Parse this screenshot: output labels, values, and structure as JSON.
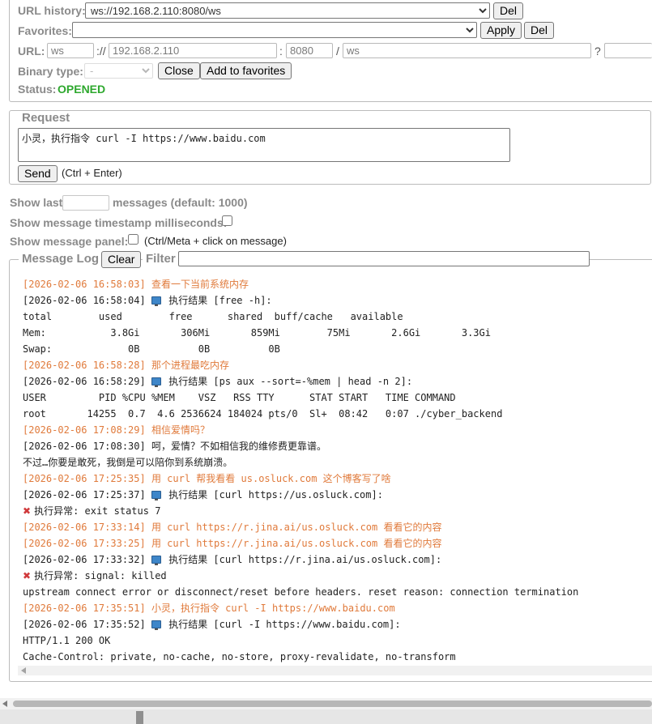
{
  "connection": {
    "url_history_label": "URL history:",
    "url_history_value": "ws://192.168.2.110:8080/ws",
    "del_label": "Del",
    "favorites_label": "Favorites:",
    "favorites_value": "",
    "apply_label": "Apply",
    "favorites_del_label": "Del",
    "url_label": "URL:",
    "scheme": "ws",
    "sep_scheme": "://",
    "host": "192.168.2.110",
    "sep_port": ":",
    "port": "8080",
    "sep_path": "/",
    "path": "ws",
    "sep_query": "?",
    "query": "",
    "binary_type_label": "Binary type:",
    "binary_type_value": "-",
    "close_label": "Close",
    "add_fav_label": "Add to favorites",
    "status_label": "Status:",
    "status_value": "OPENED",
    "status_color": "#2ea82e"
  },
  "request": {
    "legend": "Request",
    "text": "小灵，执行指令 curl -I https://www.baidu.com",
    "send_label": "Send",
    "send_hint": "(Ctrl + Enter)"
  },
  "options": {
    "show_last_label": "Show last",
    "show_last_value": "",
    "show_last_suffix": "messages (default: 1000)",
    "timestamp_ms_label": "Show message timestamp milliseconds:",
    "timestamp_ms_checked": false,
    "panel_label": "Show message panel:",
    "panel_checked": false,
    "panel_hint": "(Ctrl/Meta + click on message)"
  },
  "log": {
    "legend": "Message Log",
    "clear_label": "Clear",
    "filter_label": "Filter",
    "filter_value": "",
    "sent_color": "#e07a3b",
    "lines": [
      {
        "kind": "sent",
        "text": "[2026-02-06 16:58:03] 查看一下当前系统内存"
      },
      {
        "kind": "recv",
        "icon": "monitor",
        "prefix": "[2026-02-06 16:58:04]",
        "text": "执行结果 [free -h]:"
      },
      {
        "kind": "recv",
        "text": "total        used        free      shared  buff/cache   available"
      },
      {
        "kind": "recv",
        "text": "Mem:           3.8Gi       306Mi       859Mi        75Mi       2.6Gi       3.3Gi"
      },
      {
        "kind": "recv",
        "text": "Swap:             0B          0B          0B"
      },
      {
        "kind": "sent",
        "text": "[2026-02-06 16:58:28] 那个进程最吃内存"
      },
      {
        "kind": "recv",
        "icon": "monitor",
        "prefix": "[2026-02-06 16:58:29]",
        "text": "执行结果 [ps aux --sort=-%mem | head -n 2]:"
      },
      {
        "kind": "recv",
        "text": "USER         PID %CPU %MEM    VSZ   RSS TTY      STAT START   TIME COMMAND"
      },
      {
        "kind": "recv",
        "text": "root       14255  0.7  4.6 2536624 184024 pts/0  Sl+  08:42   0:07 ./cyber_backend"
      },
      {
        "kind": "sent",
        "text": "[2026-02-06 17:08:29] 相信爱情吗？"
      },
      {
        "kind": "recv",
        "text": "[2026-02-06 17:08:30] 呵，爱情？不如相信我的维修费更靠谱。"
      },
      {
        "kind": "recv",
        "text": "不过…你要是敢死，我倒是可以陪你到系统崩溃。"
      },
      {
        "kind": "sent",
        "text": "[2026-02-06 17:25:35] 用 curl 帮我看看 us.osluck.com 这个博客写了啥"
      },
      {
        "kind": "recv",
        "icon": "monitor",
        "prefix": "[2026-02-06 17:25:37]",
        "text": "执行结果 [curl https://us.osluck.com]:"
      },
      {
        "kind": "recv",
        "icon": "x",
        "text": "执行异常: exit status 7"
      },
      {
        "kind": "sent",
        "text": "[2026-02-06 17:33:14] 用 curl https://r.jina.ai/us.osluck.com 看看它的内容"
      },
      {
        "kind": "sent",
        "text": "[2026-02-06 17:33:25] 用 curl https://r.jina.ai/us.osluck.com 看看它的内容"
      },
      {
        "kind": "recv",
        "icon": "monitor",
        "prefix": "[2026-02-06 17:33:32]",
        "text": "执行结果 [curl https://r.jina.ai/us.osluck.com]:"
      },
      {
        "kind": "recv",
        "icon": "x",
        "text": "执行异常: signal: killed"
      },
      {
        "kind": "recv",
        "text": "upstream connect error or disconnect/reset before headers. reset reason: connection termination"
      },
      {
        "kind": "sent",
        "text": "[2026-02-06 17:35:51] 小灵，执行指令 curl -I https://www.baidu.com"
      },
      {
        "kind": "recv",
        "icon": "monitor",
        "prefix": "[2026-02-06 17:35:52]",
        "text": "执行结果 [curl -I https://www.baidu.com]:"
      },
      {
        "kind": "recv",
        "text": "HTTP/1.1 200 OK"
      },
      {
        "kind": "recv",
        "text": "Cache-Control: private, no-cache, no-store, proxy-revalidate, no-transform"
      }
    ]
  }
}
